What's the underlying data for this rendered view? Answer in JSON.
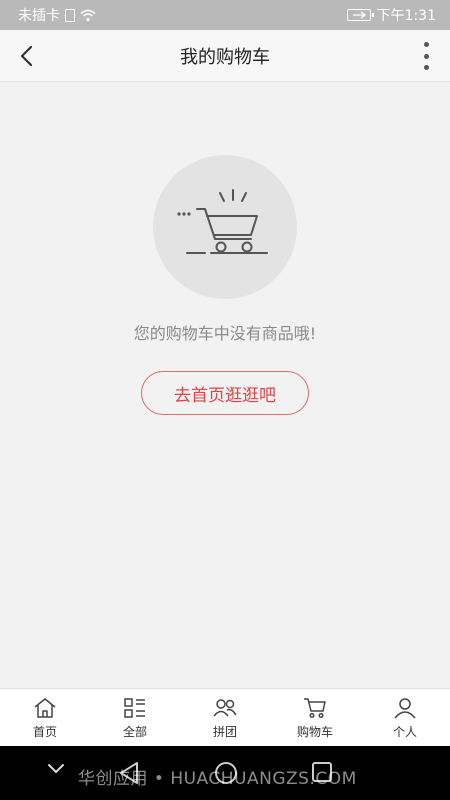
{
  "status_bar": {
    "carrier": "未插卡",
    "time": "下午1:31",
    "icons": [
      "sim-icon",
      "wifi-icon",
      "battery-icon"
    ]
  },
  "header": {
    "title": "我的购物车",
    "back_icon": "chevron-left-icon",
    "more_icon": "more-vertical-icon"
  },
  "empty_state": {
    "icon": "cart-icon",
    "message": "您的购物车中没有商品哦!",
    "button_label": "去首页逛逛吧"
  },
  "tab_bar": {
    "items": [
      {
        "label": "首页",
        "icon": "home-icon"
      },
      {
        "label": "全部",
        "icon": "list-icon"
      },
      {
        "label": "拼团",
        "icon": "group-icon"
      },
      {
        "label": "购物车",
        "icon": "cart-icon"
      },
      {
        "label": "个人",
        "icon": "user-icon"
      }
    ]
  },
  "system_nav": {
    "watermark": "华创应用 • HUACHUANGZS.COM"
  },
  "colors": {
    "accent": "#e04545",
    "header_bg": "#f7f7f7",
    "page_bg": "#f2f2f2",
    "status_bg": "#b9b9b9"
  }
}
